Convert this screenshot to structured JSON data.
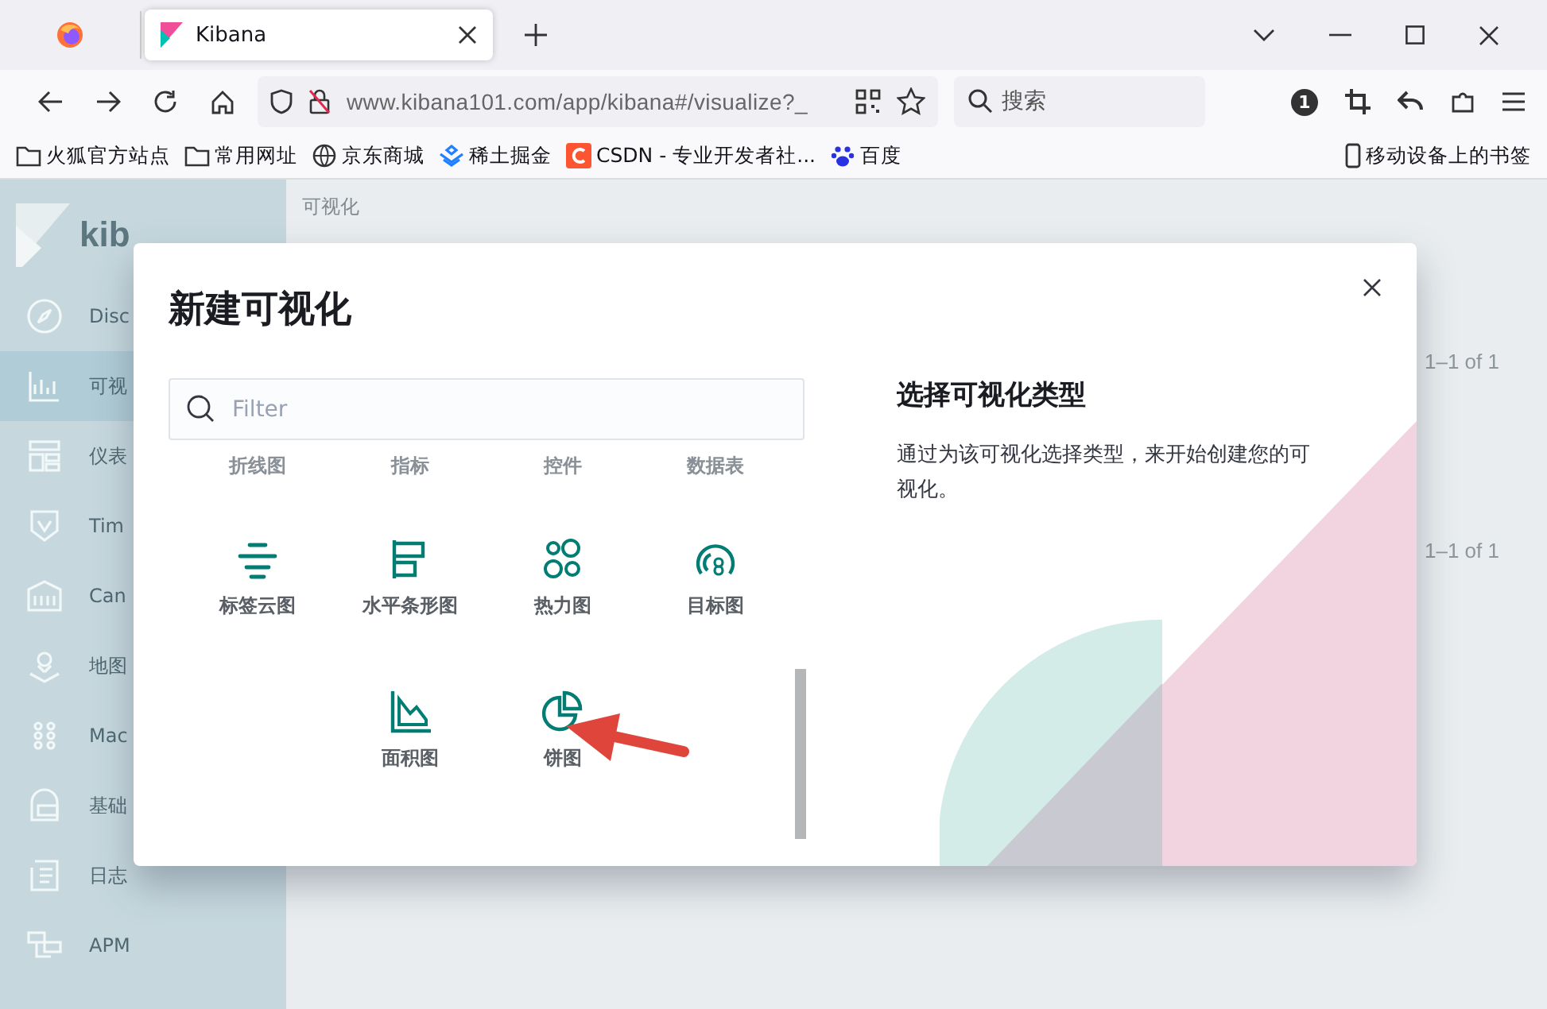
{
  "browser": {
    "tab": {
      "title": "Kibana",
      "selected": true
    },
    "url": "www.kibana101.com/app/kibana#/visualize?_",
    "search": {
      "placeholder": "搜索"
    },
    "extension_badge": "1",
    "bookmarks": [
      {
        "label": "火狐官方站点",
        "kind": "folder"
      },
      {
        "label": "常用网址",
        "kind": "folder"
      },
      {
        "label": "京东商城",
        "kind": "globe"
      },
      {
        "label": "稀土掘金",
        "kind": "juejin"
      },
      {
        "label": "CSDN - 专业开发者社...",
        "kind": "csdn"
      },
      {
        "label": "百度",
        "kind": "baidu"
      }
    ],
    "mobile_bookmarks": "移动设备上的书签"
  },
  "sidebar": {
    "logo": "kib",
    "items": [
      {
        "label": "Disc",
        "selected": false
      },
      {
        "label": "可视",
        "selected": true
      },
      {
        "label": "仪表",
        "selected": false
      },
      {
        "label": "Tim",
        "selected": false
      },
      {
        "label": "Can",
        "selected": false
      },
      {
        "label": "地图",
        "selected": false
      },
      {
        "label": "Mac",
        "selected": false
      },
      {
        "label": "基础",
        "selected": false
      },
      {
        "label": "日志",
        "selected": false
      },
      {
        "label": "APM",
        "selected": false
      }
    ]
  },
  "main": {
    "breadcrumb": "可视化",
    "pagination": [
      "1–1 of 1",
      "1–1 of 1"
    ]
  },
  "modal": {
    "title": "新建可视化",
    "filter": {
      "placeholder": "Filter"
    },
    "type_rows": [
      [
        {
          "label": "折线图",
          "kind": "hidden"
        },
        {
          "label": "指标",
          "kind": "hidden"
        },
        {
          "label": "控件",
          "kind": "hidden"
        },
        {
          "label": "数据表",
          "kind": "hidden"
        }
      ],
      [
        {
          "label": "标签云图",
          "kind": "tagcloud"
        },
        {
          "label": "水平条形图",
          "kind": "hbar"
        },
        {
          "label": "热力图",
          "kind": "heatmap"
        },
        {
          "label": "目标图",
          "kind": "goal"
        }
      ],
      [
        {
          "label": "面积图",
          "kind": "area"
        },
        {
          "label": "饼图",
          "kind": "pie"
        }
      ]
    ],
    "side_title": "选择可视化类型",
    "side_text": "通过为该可视化选择类型，来开始创建您的可视化。"
  }
}
